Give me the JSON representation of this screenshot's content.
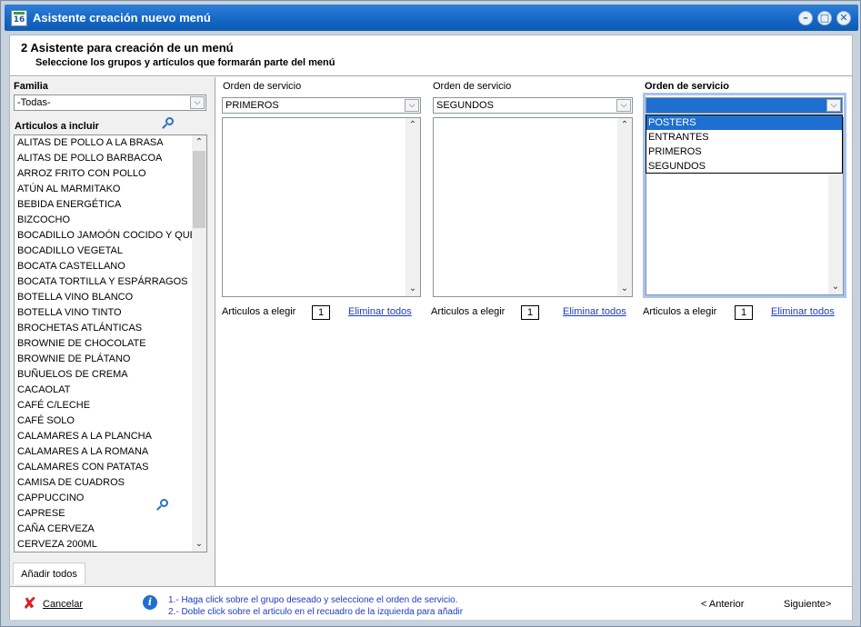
{
  "window": {
    "title": "Asistente creación nuevo menú",
    "icon_label": "16"
  },
  "header": {
    "title": "2 Asistente para creación de un menú",
    "subtitle": "Seleccione los grupos y artículos que formarán parte del menú"
  },
  "left": {
    "familia_label": "Familia",
    "familia_value": "-Todas-",
    "articulos_label": "Articulos a incluir",
    "items": [
      "ALITAS DE POLLO A LA BRASA",
      "ALITAS DE POLLO BARBACOA",
      "ARROZ FRITO CON POLLO",
      "ATÚN AL MARMITAKO",
      "BEBIDA ENERGÉTICA",
      "BIZCOCHO",
      "BOCADILLO JAMOÓN COCIDO Y QUESO",
      "BOCADILLO VEGETAL",
      "BOCATA CASTELLANO",
      "BOCATA TORTILLA Y ESPÁRRAGOS",
      "BOTELLA VINO BLANCO",
      "BOTELLA VINO TINTO",
      "BROCHETAS ATLÁNTICAS",
      "BROWNIE DE CHOCOLATE",
      "BROWNIE DE PLÁTANO",
      "BUÑUELOS DE CREMA",
      "CACAOLAT",
      "CAFÉ C/LECHE",
      "CAFÉ SOLO",
      "CALAMARES A LA PLANCHA",
      "CALAMARES A LA ROMANA",
      "CALAMARES CON PATATAS",
      "CAMISA DE CUADROS",
      "CAPPUCCINO",
      "CAPRESE",
      "CAÑA CERVEZA",
      "CERVEZA 200ML"
    ],
    "add_all": "Añadir todos"
  },
  "columns": [
    {
      "label": "Orden de servicio",
      "value": "PRIMEROS",
      "choose_label": "Articulos a elegir",
      "count": "1",
      "clear": "Eliminar todos"
    },
    {
      "label": "Orden de servicio",
      "value": "SEGUNDOS",
      "choose_label": "Articulos a elegir",
      "count": "1",
      "clear": "Eliminar todos"
    },
    {
      "label": "Orden de servicio",
      "value": "",
      "choose_label": "Articulos a elegir",
      "count": "1",
      "clear": "Eliminar todos"
    }
  ],
  "dropdown": {
    "options": [
      "POSTERS",
      "ENTRANTES",
      "PRIMEROS",
      "SEGUNDOS"
    ],
    "selected": "POSTERS"
  },
  "footer": {
    "cancel": "Cancelar",
    "hint1": "1.- Haga click sobre el grupo deseado y seleccione el orden de servicio.",
    "hint2": "2.- Doble click sobre el articulo en el recuadro de la izquierda para añadir",
    "back": "< Anterior",
    "next": "Siguiente>"
  },
  "colors": {
    "titlebar": "#1366c4",
    "selection": "#1f6fd0",
    "link": "#1d3cc4"
  }
}
